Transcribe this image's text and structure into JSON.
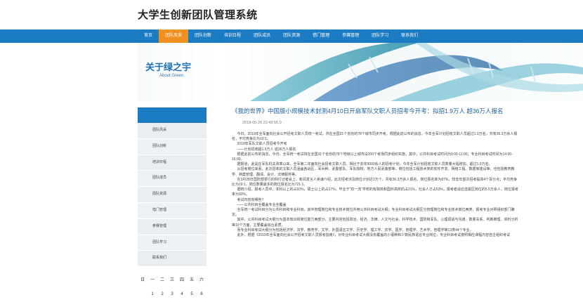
{
  "site": {
    "title": "大学生创新团队管理系统"
  },
  "nav": {
    "items": [
      {
        "label": "首页",
        "active": false
      },
      {
        "label": "团队风采",
        "active": true
      },
      {
        "label": "团队创新",
        "active": false
      },
      {
        "label": "培训日程",
        "active": false
      },
      {
        "label": "团队成员",
        "active": false
      },
      {
        "label": "团队资源",
        "active": false
      },
      {
        "label": "借门管理",
        "active": false
      },
      {
        "label": "参赛管理",
        "active": false
      },
      {
        "label": "团队学习",
        "active": false
      },
      {
        "label": "联系我们",
        "active": false
      }
    ]
  },
  "banner": {
    "title": "关于绿之宇",
    "subtitle": "About Green"
  },
  "sidebar": {
    "items": [
      {
        "label": "团队风采"
      },
      {
        "label": "团队创新"
      },
      {
        "label": "培训日程"
      },
      {
        "label": "团队成员"
      },
      {
        "label": "团队资源"
      },
      {
        "label": "借门管理"
      },
      {
        "label": "参赛管理"
      },
      {
        "label": "团队学习"
      },
      {
        "label": "联系我们"
      }
    ]
  },
  "calendar": {
    "weekdays": [
      "日",
      "一",
      "二",
      "三",
      "四",
      "五",
      "六"
    ],
    "days": [
      "",
      "1",
      "2",
      "3",
      "4",
      "5",
      "6"
    ]
  },
  "article": {
    "title": "《我的世界》中国版小规模技术封测4月10日开启军队文职人员招考今开考：拟招1.9万人 超36万人报名",
    "date": "2018-05-26 22:43:55.0",
    "paragraphs": [
      "今日，2019年全军面向社会公开招考文职人员统一考试，共在全国31个省份的78个城市同步开考。根据此前公布的消息，今年全军计划招收文职人员超过1.9万名，共有36.3万余人报名，平均竞争比为19:1。",
      "2019年军队文职人员招考今开考",
      "——计划招收超1.9万人 逾36万人报名",
      "根据此前公布的消息，今日，全军统一考试将在全国31个省份的78个地级以上城市设200个考场同步组织实施，其中，公共科目考试时间为9:00-11:00；专业科目考试时间为14:00-16:00。",
      "据报道，此是在军队机关改革以来，全军第二年面向社会招考文职人员。相比于去年9000余人的招考计划，今年全军计划招收文职人员数量大幅增加，超过1.9万名。",
      "从招考岗位来看，此次招收的文职人员涵盖各战区、军兵种、武警部队、军队院校、地方人民武装部等，岗位包括工程技术类的软件开发、网络工程、数据库建设等，也包括教育教学、档案管理、翻译、会计、法律服务等。",
      "在3月28日国防部举行的例行记者会上，新闻发言人吴谦介绍，此次招考涉及岗位计划近2万个，共有36.3万余人报名，岗位报名率为87%，较去年首次招考提高4个百分点；平均竞争比为19:1，岗位数量最多的岗位报名比为721:1。",
      "据统介绍，报考人员中，本科以上的占93%，硕士以上的占17%，毕业于“双一流”学校的有院校和国外高校的占21%，社会人才占53%，报考者适应选拔区岗位的5.5万余人，岗位报考率为92%。",
      "考试内容有哪些？",
      "——公共科目全覆盖专业全覆盖",
      "全军统一考试科目分为公共科目和专业科目，其中管理岗位和专业技术岗位共用公共科目考试大纲；专业科目考试大纲区分管理岗位和专业技术岗位两类，报考专业对照组织部门确定。",
      "其中，公共科目考试大纲分为基本知识和岗位能力两部分，主要内容包括政治、经济、法律、人文与社会、科学技术、国防和军队、心理调适与沟通、数量关系、判断推理、资料分析等10个方面，主要覆盖综合素质。",
      "而专业科目考试大纲分为包括经济学、法学、教育学、文学、外国语言文学、历史学、理工学、农学、医学、管理学、艺术学、管理学等13类44个专业。",
      "此外，根据《2019年全军面向社会公开招考文职人员报考指南》，对专业科目考试大纲没有覆盖的小语种和少数民族语言专业岗位，专业科目考试按照相应课程内容自主组织考试"
    ]
  }
}
